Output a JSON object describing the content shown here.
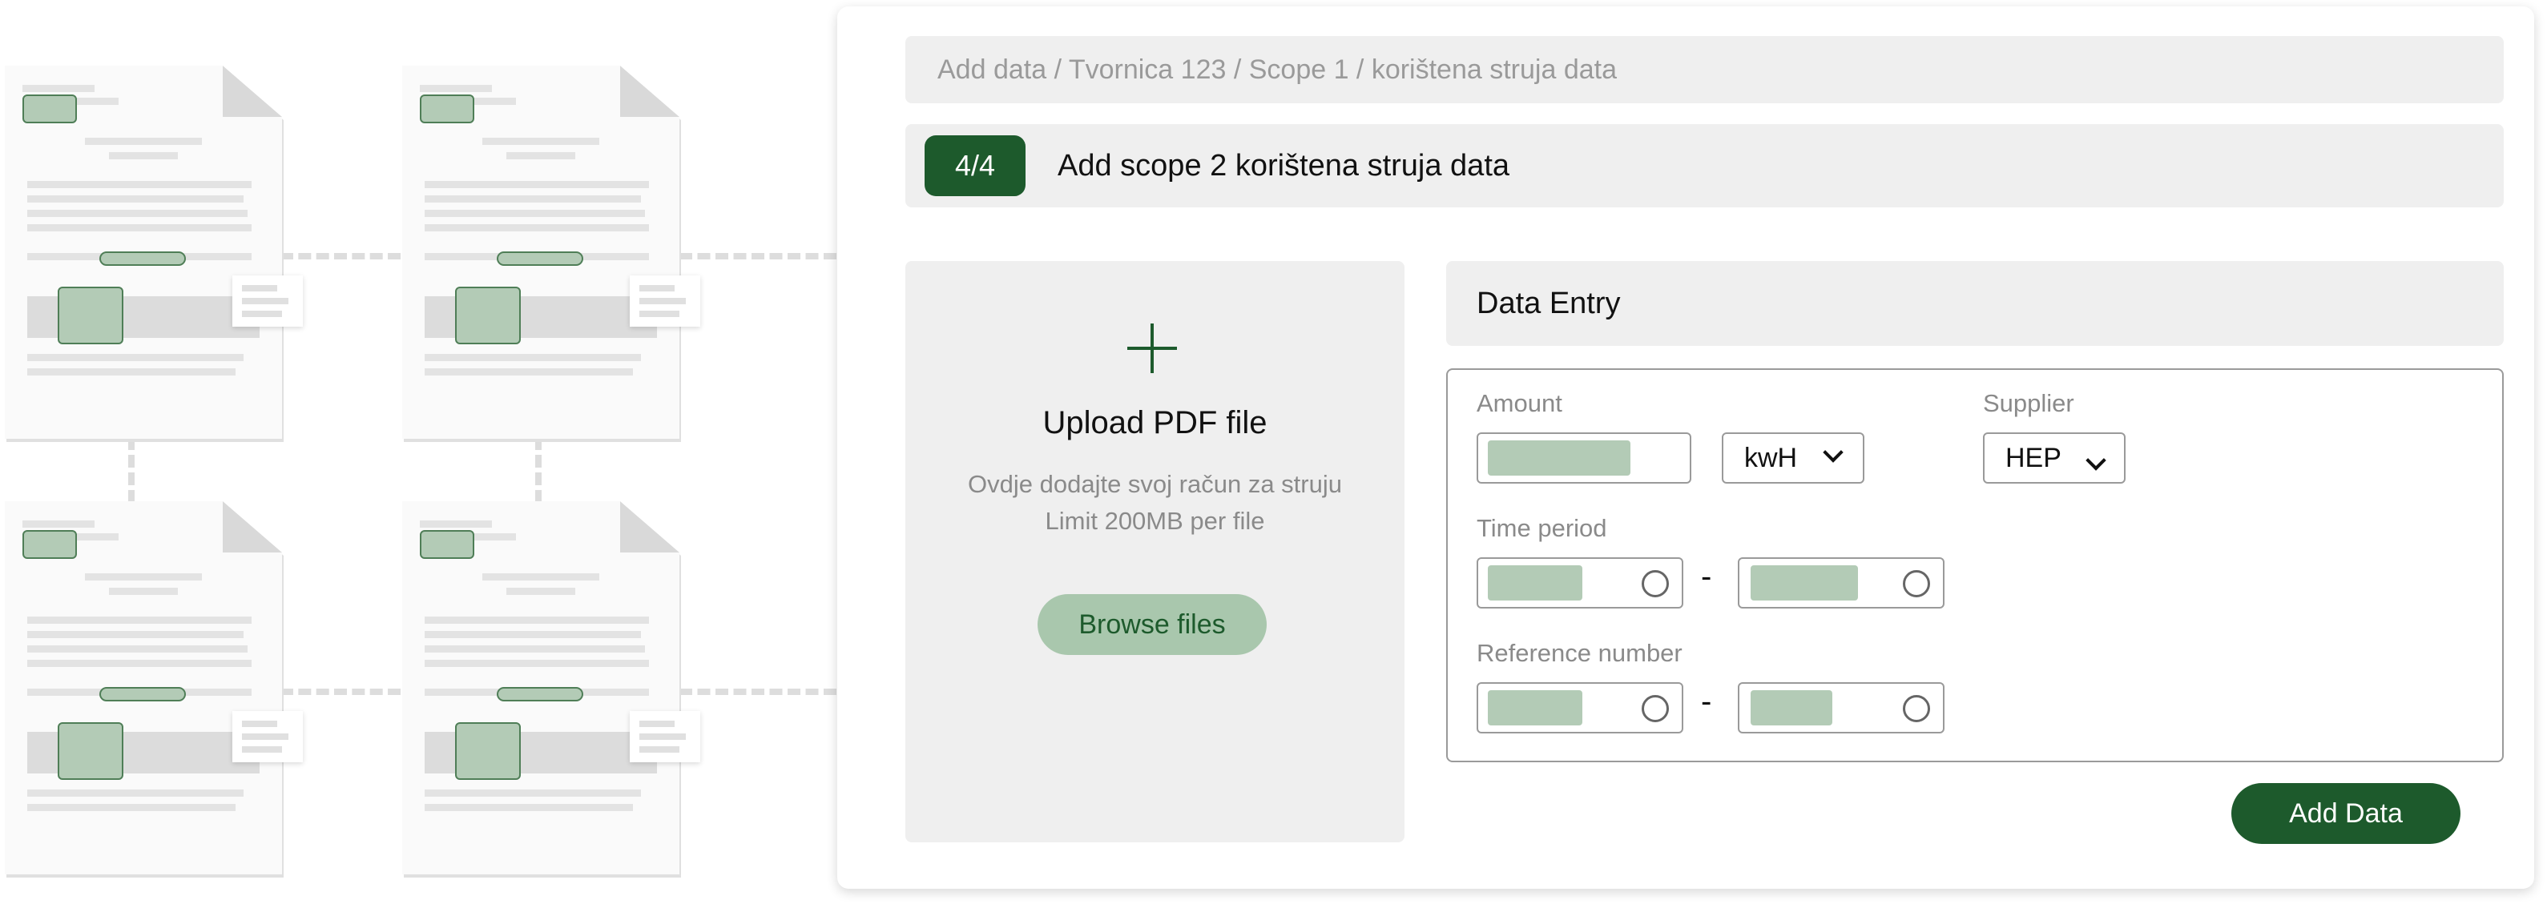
{
  "breadcrumb": "Add data / Tvornica 123 / Scope 1 / korištena struja data",
  "step": {
    "badge": "4/4",
    "title": "Add scope 2 korištena struja data"
  },
  "upload": {
    "icon": "plus-icon",
    "title": "Upload PDF file",
    "description_line1": "Ovdje dodajte svoj račun za struju",
    "description_line2": "Limit 200MB per file",
    "browse_label": "Browse files"
  },
  "data_entry": {
    "header": "Data Entry",
    "amount_label": "Amount",
    "unit_value": "kwH",
    "supplier_label": "Supplier",
    "supplier_value": "HEP",
    "time_period_label": "Time period",
    "reference_number_label": "Reference number",
    "range_separator": "-"
  },
  "add_data_label": "Add Data",
  "colors": {
    "accent": "#1d5a2c",
    "accent_light": "#a9c7ad",
    "panel": "#efefef",
    "muted_text": "#8a8a8a"
  }
}
